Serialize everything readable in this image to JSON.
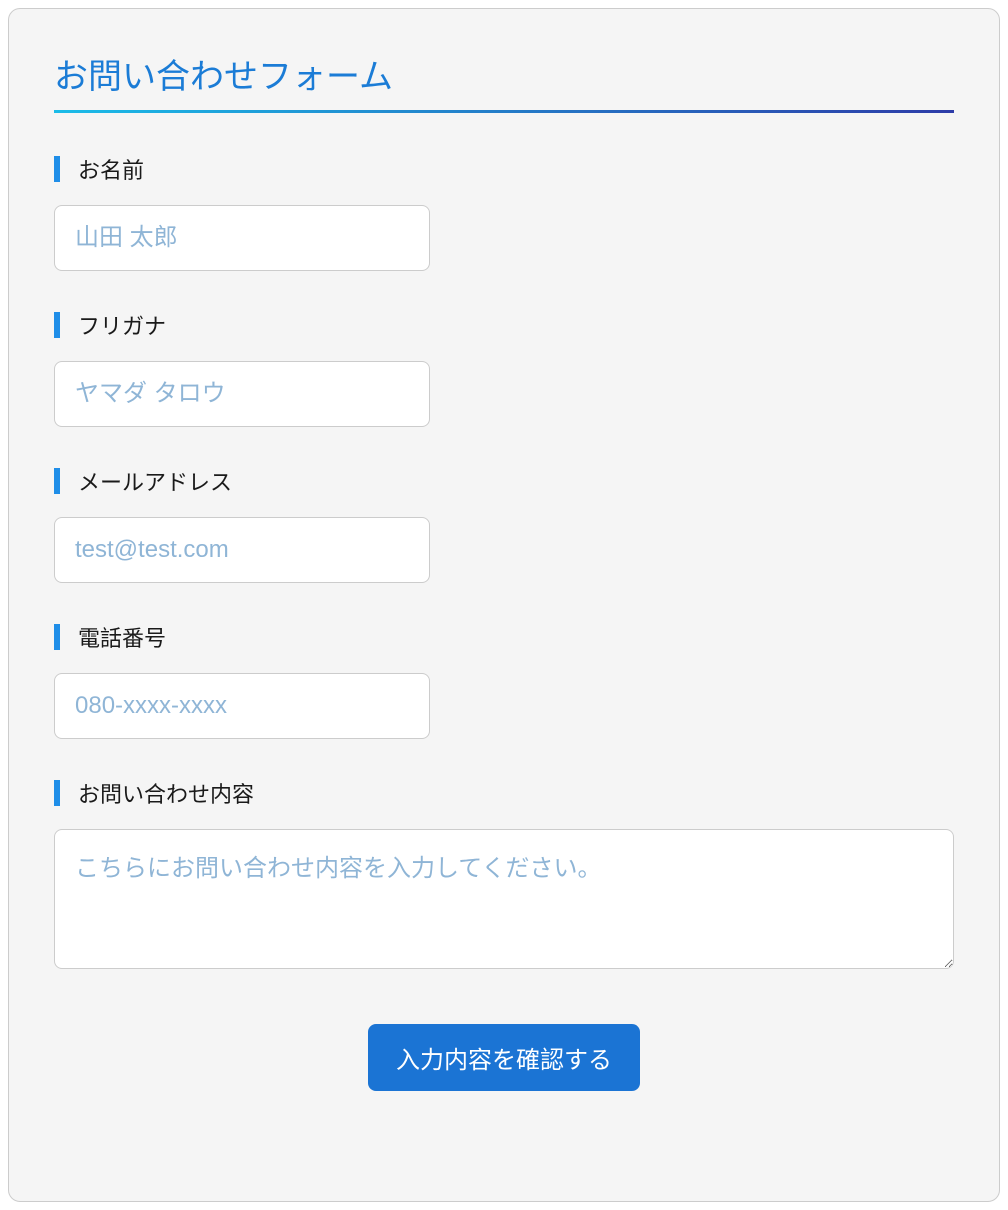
{
  "form": {
    "title": "お問い合わせフォーム",
    "fields": {
      "name": {
        "label": "お名前",
        "placeholder": "山田 太郎",
        "value": ""
      },
      "furigana": {
        "label": "フリガナ",
        "placeholder": "ヤマダ タロウ",
        "value": ""
      },
      "email": {
        "label": "メールアドレス",
        "placeholder": "test@test.com",
        "value": ""
      },
      "phone": {
        "label": "電話番号",
        "placeholder": "080-xxxx-xxxx",
        "value": ""
      },
      "message": {
        "label": "お問い合わせ内容",
        "placeholder": "こちらにお問い合わせ内容を入力してください。",
        "value": ""
      }
    },
    "submit_label": "入力内容を確認する"
  }
}
